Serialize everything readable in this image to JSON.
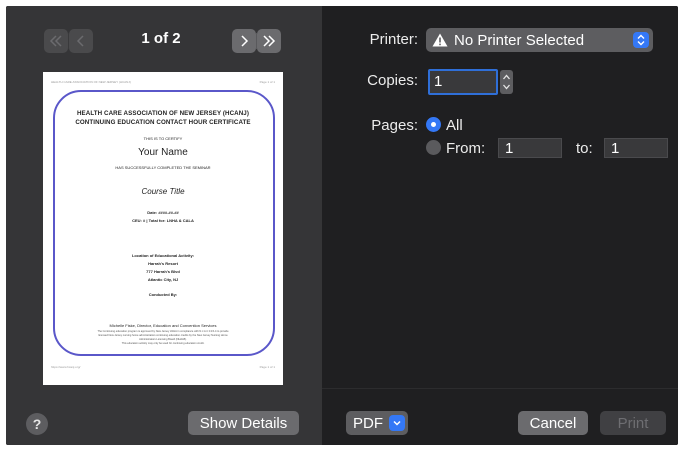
{
  "navigation": {
    "first_icon": "double-chevron-left-icon",
    "prev_icon": "chevron-left-icon",
    "next_icon": "chevron-right-icon",
    "last_icon": "double-chevron-right-icon",
    "page_indicator": "1 of 2"
  },
  "preview": {
    "header_left": "HEALTH CARE ASSOCIATION OF NEW JERSEY (HCANJ)",
    "header_right": "Page 1 of 1",
    "heading_line1": "HEALTH CARE ASSOCIATION OF NEW JERSEY (HCANJ)",
    "heading_line2": "CONTINUING EDUCATION CONTACT HOUR CERTIFICATE",
    "certify": "THIS IS TO CERTIFY",
    "name": "Your Name",
    "completed": "HAS SUCCESSFULLY COMPLETED THE SEMINAR",
    "course": "Course Title",
    "date": "Date: ####-##-##",
    "ceu": "CEU: # | Total for: LNHA & CALA",
    "location_label": "Location of Educational Activity:",
    "location_name": "Harrah's Resort",
    "location_address": "777 Harrah's Blvd",
    "location_city": "Atlantic City, NJ",
    "conducted": "Conducted By:",
    "signer": "Michelle Fiske, Director, Education and Convention Services",
    "fine_print_1": "The Continuing education program is approved by New Jersey LNHA in compliance with N.J.A.C 13:6-4 to provide",
    "fine_print_2": "licensed New Jersey nursing home administrators continuing education credits by the New Jersey Nursing Home",
    "fine_print_3": "Administrators Licensing Board (NHALB).",
    "fine_print_4": "This education activity may only be used for continuing education credit.",
    "footer_left": "https://www.hcanj.org/",
    "footer_right": "Page 1 of 1"
  },
  "left_footer": {
    "help_icon": "question-mark-icon",
    "help_label": "?",
    "show_details_label": "Show Details"
  },
  "printer": {
    "label": "Printer:",
    "value": "No Printer Selected",
    "status_icon": "warning-triangle-icon"
  },
  "copies": {
    "label": "Copies:",
    "value": "1"
  },
  "pages": {
    "label": "Pages:",
    "all_label": "All",
    "from_label": "From:",
    "from_value": "1",
    "to_label": "to:",
    "to_value": "1",
    "selected": "All"
  },
  "footer": {
    "pdf_label": "PDF",
    "cancel_label": "Cancel",
    "print_label": "Print"
  },
  "colors": {
    "accent": "#3478f6",
    "panel_left": "#353537",
    "panel_right": "#1f1f21",
    "certificate_border": "#5a57c9"
  }
}
